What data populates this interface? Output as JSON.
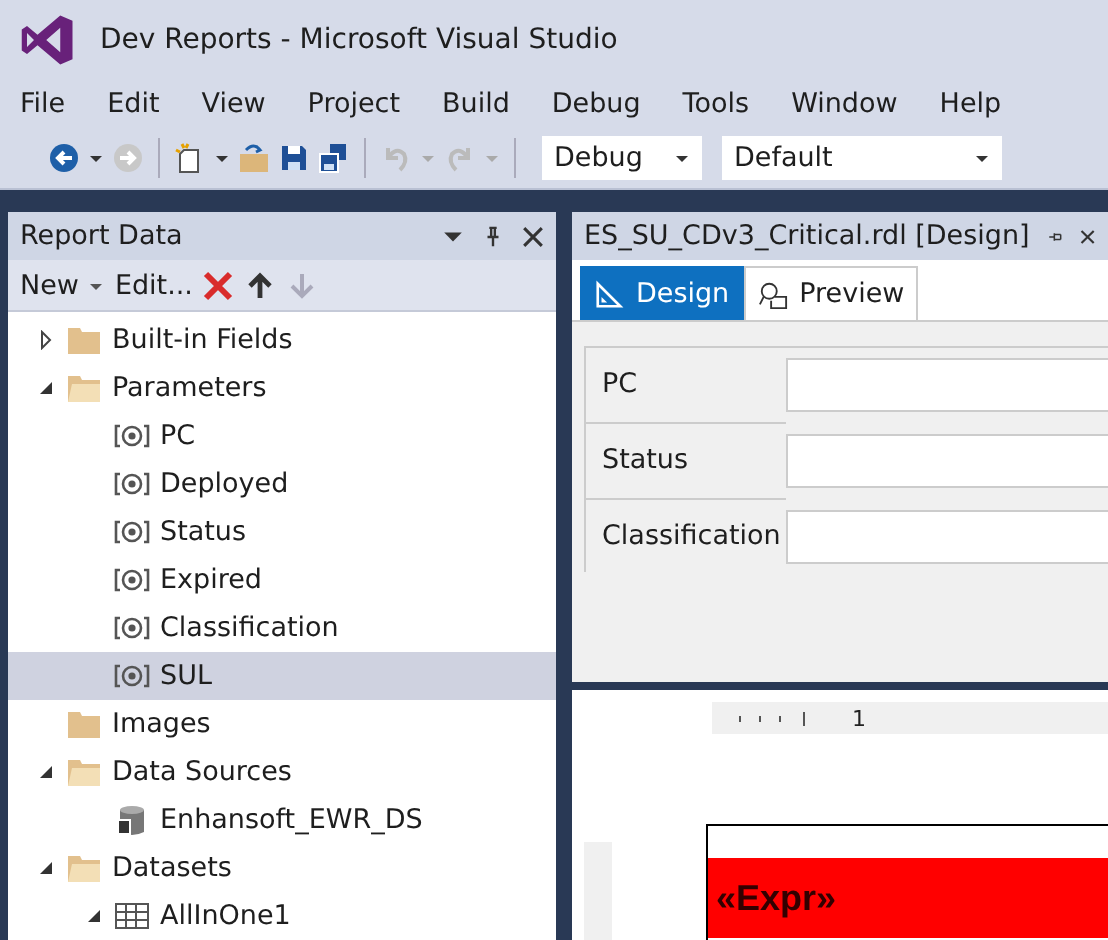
{
  "window": {
    "title": "Dev Reports - Microsoft Visual Studio"
  },
  "menu": [
    "File",
    "Edit",
    "View",
    "Project",
    "Build",
    "Debug",
    "Tools",
    "Window",
    "Help"
  ],
  "toolbar": {
    "configuration": "Debug",
    "platform": "Default"
  },
  "report_data": {
    "title": "Report Data",
    "tools": {
      "new": "New",
      "edit": "Edit..."
    },
    "tree": [
      {
        "label": "Built-in Fields",
        "kind": "folder",
        "expanded": false,
        "selected": false
      },
      {
        "label": "Parameters",
        "kind": "folder",
        "expanded": true,
        "selected": false,
        "children": [
          {
            "label": "PC",
            "kind": "parameter",
            "selected": false
          },
          {
            "label": "Deployed",
            "kind": "parameter",
            "selected": false
          },
          {
            "label": "Status",
            "kind": "parameter",
            "selected": false
          },
          {
            "label": "Expired",
            "kind": "parameter",
            "selected": false
          },
          {
            "label": "Classification",
            "kind": "parameter",
            "selected": false
          },
          {
            "label": "SUL",
            "kind": "parameter",
            "selected": true
          }
        ]
      },
      {
        "label": "Images",
        "kind": "folder",
        "selected": false
      },
      {
        "label": "Data Sources",
        "kind": "folder",
        "expanded": true,
        "selected": false,
        "children": [
          {
            "label": "Enhansoft_EWR_DS",
            "kind": "datasource",
            "selected": false
          }
        ]
      },
      {
        "label": "Datasets",
        "kind": "folder",
        "expanded": true,
        "selected": false,
        "children": [
          {
            "label": "AllInOne1",
            "kind": "dataset",
            "expanded": true,
            "selected": false
          }
        ]
      }
    ]
  },
  "document": {
    "title": "ES_SU_CDv3_Critical.rdl [Design]",
    "tabs": [
      {
        "label": "Design",
        "selected": true
      },
      {
        "label": "Preview",
        "selected": false
      }
    ],
    "parameters": [
      "PC",
      "Status",
      "Classification"
    ],
    "ruler": "1",
    "expression": "«Expr»"
  }
}
